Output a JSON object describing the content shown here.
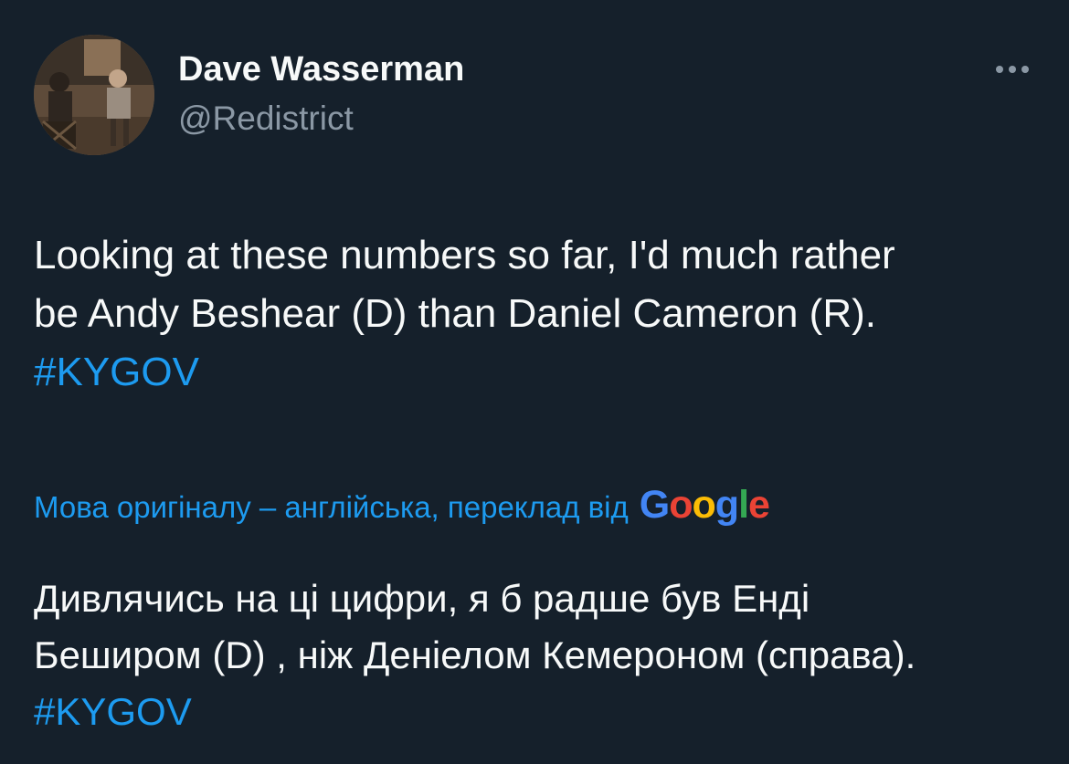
{
  "author": {
    "display_name": "Dave Wasserman",
    "handle": "@Redistrict"
  },
  "tweet": {
    "lines": [
      "Looking at these numbers so far, I'd much rather",
      "be Andy Beshear (D) than Daniel Cameron (R)."
    ],
    "hashtag": "#KYGOV"
  },
  "translation": {
    "note": "Мова оригіналу – англійська, переклад від",
    "provider": {
      "letters": [
        "G",
        "o",
        "o",
        "g",
        "l",
        "e"
      ]
    },
    "lines": [
      "Дивлячись на ці цифри, я б радше був Енді",
      "Беширом (D) , ніж Деніелом Кемероном (справа)."
    ],
    "hashtag": "#KYGOV"
  },
  "colors": {
    "background": "#15202b",
    "text": "#f7f9f9",
    "secondary": "#8b98a5",
    "link": "#1d9bf0"
  },
  "icons": {
    "more": "more-horizontal-icon"
  }
}
